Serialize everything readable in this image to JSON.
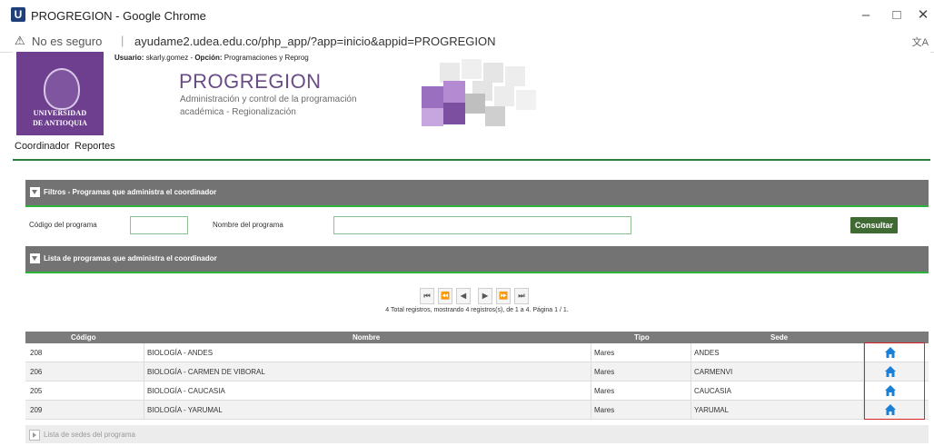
{
  "window": {
    "title": "PROGREGION - Google Chrome",
    "app_icon_letter": "U",
    "minimize": "–",
    "maximize": "□",
    "close": "✕"
  },
  "address": {
    "security_label": "No es seguro",
    "url": "ayudame2.udea.edu.co/php_app/?app=inicio&appid=PROGREGION"
  },
  "header": {
    "logo_line1": "UNIVERSIDAD",
    "logo_line2": "DE ANTIOQUIA",
    "user_label": "Usuario:",
    "user_value": "skarly.gomez",
    "option_label": "Opción:",
    "option_value": "Programaciones y Reprog",
    "app_name": "PROGREGION",
    "app_sub1": "Administración y control de la programación",
    "app_sub2": "académica - Regionalización"
  },
  "menu": {
    "items": [
      "Coordinador",
      "Reportes"
    ]
  },
  "filters": {
    "section_title": "Filtros - Programas que administra el coordinador",
    "code_label": "Código del programa",
    "code_value": "",
    "name_label": "Nombre del programa",
    "name_value": "",
    "submit_label": "Consultar"
  },
  "list": {
    "section_title": "Lista de programas que administra el coordinador",
    "pager": {
      "first": "⏮",
      "prev_page": "⏪",
      "prev": "◀",
      "next": "▶",
      "next_page": "⏩",
      "last": "⏭",
      "info": "4 Total registros, mostrando 4 registros(s), de 1 a 4. Página 1 / 1."
    },
    "columns": [
      "Código",
      "Nombre",
      "Tipo",
      "Sede"
    ],
    "rows": [
      {
        "codigo": "208",
        "nombre": "BIOLOGÍA - ANDES",
        "tipo": "Mares",
        "sede": "ANDES"
      },
      {
        "codigo": "206",
        "nombre": "BIOLOGÍA - CARMEN DE VIBORAL",
        "tipo": "Mares",
        "sede": "CARMENVI"
      },
      {
        "codigo": "205",
        "nombre": "BIOLOGÍA - CAUCASIA",
        "tipo": "Mares",
        "sede": "CAUCASIA"
      },
      {
        "codigo": "209",
        "nombre": "BIOLOGÍA - YARUMAL",
        "tipo": "Mares",
        "sede": "YARUMAL"
      }
    ],
    "row_action_icon": "home-icon"
  },
  "footer": {
    "section_title": "Lista de sedes del programa"
  },
  "colors": {
    "brand_purple": "#6d3f8e",
    "section_gray": "#737373",
    "accent_green": "#2bb33a",
    "button_green": "#3f6b33",
    "highlight_red": "#d9242a",
    "home_blue": "#1a7fd6"
  }
}
